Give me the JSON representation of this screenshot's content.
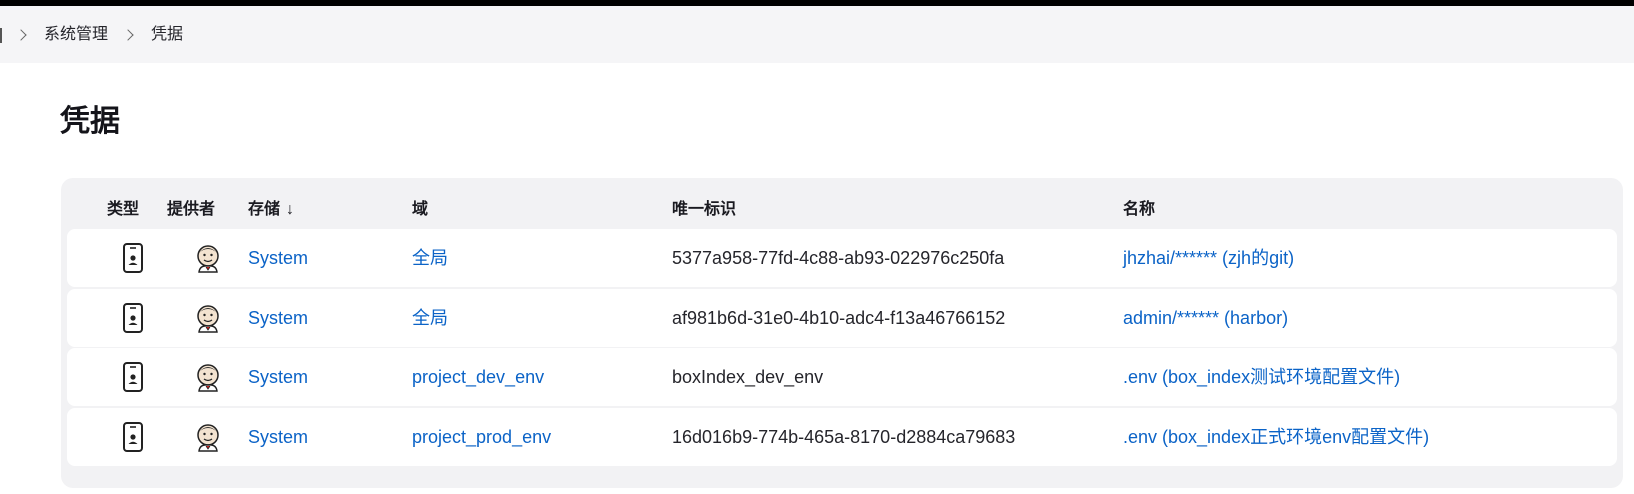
{
  "breadcrumb": {
    "items": [
      "系统管理",
      "凭据"
    ]
  },
  "page": {
    "title": "凭据"
  },
  "table": {
    "headers": {
      "type": "类型",
      "provider": "提供者",
      "store": "存储",
      "store_sort": "↓",
      "domain": "域",
      "id": "唯一标识",
      "name": "名称"
    },
    "rows": [
      {
        "type_icon": "credential-icon",
        "provider_icon": "jenkins-icon",
        "store": "System",
        "domain": "全局",
        "id": "5377a958-77fd-4c88-ab93-022976c250fa",
        "name": "jhzhai/****** (zjh的git)"
      },
      {
        "type_icon": "credential-icon",
        "provider_icon": "jenkins-icon",
        "store": "System",
        "domain": "全局",
        "id": "af981b6d-31e0-4b10-adc4-f13a46766152",
        "name": "admin/****** (harbor)"
      },
      {
        "type_icon": "credential-icon",
        "provider_icon": "jenkins-icon",
        "store": "System",
        "domain": "project_dev_env",
        "id": "boxIndex_dev_env",
        "name": ".env (box_index测试环境配置文件)"
      },
      {
        "type_icon": "credential-icon",
        "provider_icon": "jenkins-icon",
        "store": "System",
        "domain": "project_prod_env",
        "id": "16d016b9-774b-465a-8170-d2884ca79683",
        "name": ".env (box_index正式环境env配置文件)"
      }
    ]
  },
  "colors": {
    "link": "#0b63c7",
    "background_bar": "#f5f5f7",
    "table_card": "#f2f2f4"
  }
}
